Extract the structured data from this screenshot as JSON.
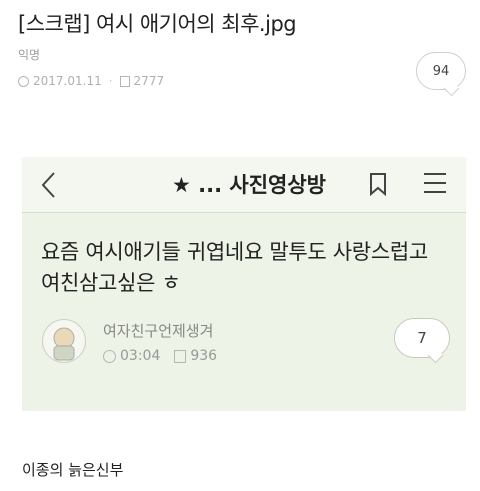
{
  "post": {
    "title": "[스크랩] 여시 애기어의 최후.jpg",
    "author": "익명",
    "date": "2017.01.11",
    "views": "2777",
    "comments": "94"
  },
  "screenshot": {
    "header_title": "★ ... 사진영상방",
    "post_text": "요즘 여시애기들 귀엽네요 말투도 사랑스럽고 여친삼고싶은 ㅎ",
    "author": "여자친구언제생겨",
    "time": "03:04",
    "views": "936",
    "comments": "7",
    "icons": [
      "back-icon",
      "bookmark-icon",
      "menu-icon",
      "clock-icon",
      "views-icon"
    ]
  },
  "footer": {
    "text": "이종의 늙은신부"
  }
}
